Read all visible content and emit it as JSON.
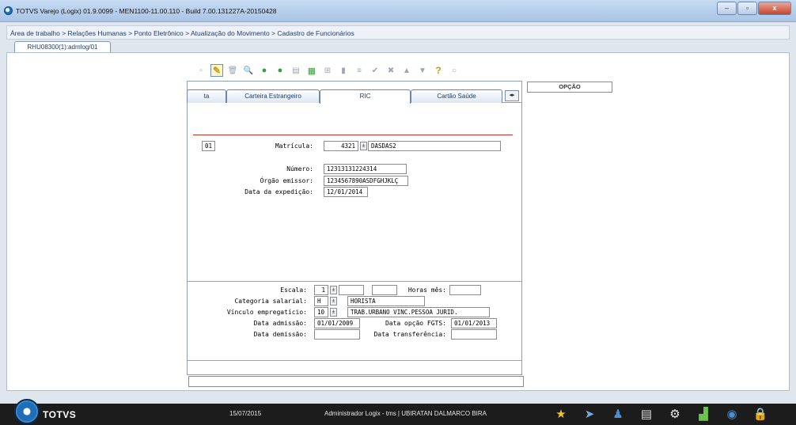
{
  "window": {
    "title": "TOTVS Varejo (Logix) 01.9.0099  -  MEN1100-11.00.110 - Build 7.00.131227A-20150428",
    "min": "–",
    "max": "▫",
    "close": "x"
  },
  "breadcrumb": "Área de trabalho > Relações Humanas > Ponto Eletrônico > Atualização do Movimento > Cadastro de Funcionários",
  "doc_tab": "RHU08300(1):admlog/01",
  "toolbar": {
    "icons": [
      "new-icon",
      "edit-icon",
      "delete-icon",
      "search-icon",
      "first-icon",
      "next-icon",
      "print-icon",
      "export-icon",
      "binoculars-icon",
      "detail-icon",
      "list-icon",
      "confirm-icon",
      "cancel-icon",
      "up-icon",
      "down-icon",
      "help-icon",
      "comment-icon"
    ]
  },
  "field_tabs": [
    "ta",
    "Carteira Estrangeiro",
    "RIC",
    "Cartão Saúde"
  ],
  "scroll_arrows": "◂▸",
  "opcao_label": "OPÇÃO",
  "form": {
    "empresa": "01",
    "matricula_label": "Matrícula:",
    "matricula": "4321",
    "nome": "DASDAS2",
    "numero_label": "Número:",
    "numero": "12313131224314",
    "orgao_label": "Órgão emissor:",
    "orgao": "1234567890ASDFGHJKLÇ",
    "data_exp_label": "Data da expedição:",
    "data_exp": "12/01/2014"
  },
  "bottom": {
    "escala_label": "Escala:",
    "escala": "1",
    "horas_label": "Horas mês:",
    "categoria_label": "Categoria salarial:",
    "categoria": "H",
    "categoria_desc": "HORISTA",
    "vinculo_label": "Vínculo empregatício:",
    "vinculo": "10",
    "vinculo_desc": "TRAB.URBANO VINC.PESSOA JURID.",
    "admissao_label": "Data admissão:",
    "admissao": "01/01/2009",
    "opcao_fgts_label": "Data opção FGTS:",
    "opcao_fgts": "01/01/2013",
    "demissao_label": "Data demissão:",
    "transf_label": "Data transferência:"
  },
  "taskbar": {
    "logo": "TOTVS",
    "date": "15/07/2015",
    "user": "Administrador Logix - tms | UBIRATAN DALMARCO BIRA"
  }
}
